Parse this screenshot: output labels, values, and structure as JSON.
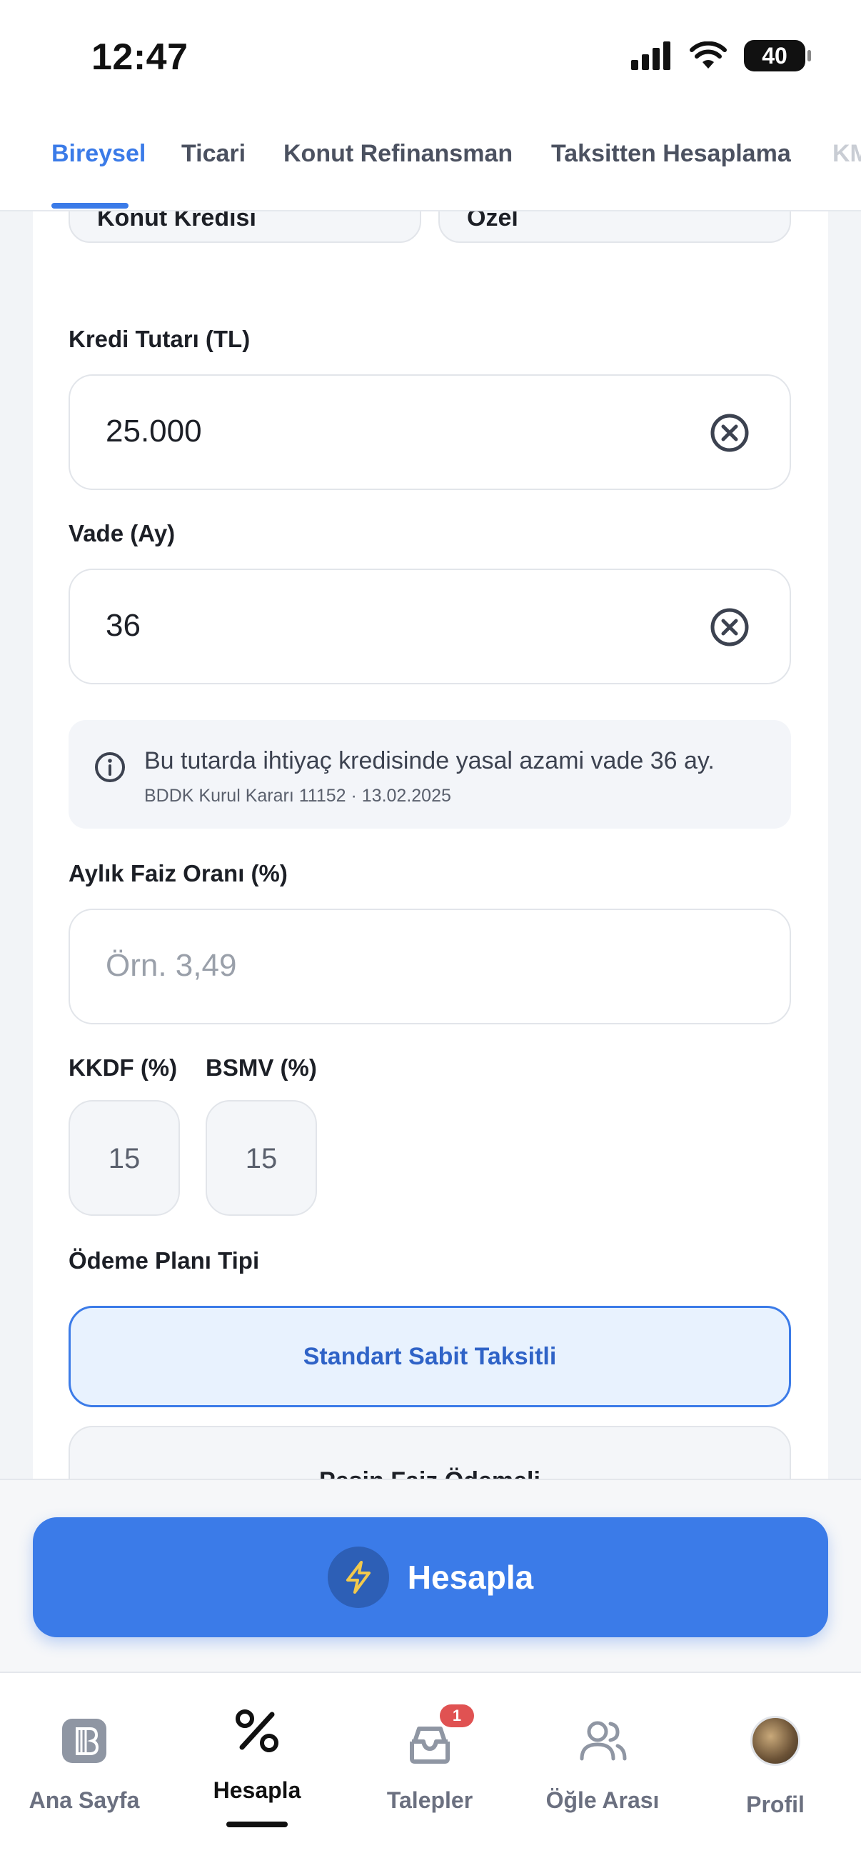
{
  "status_bar": {
    "time": "12:47",
    "battery": "40"
  },
  "tabs": [
    {
      "label": "Bireysel",
      "active": true
    },
    {
      "label": "Ticari"
    },
    {
      "label": "Konut Refinansman"
    },
    {
      "label": "Taksitten Hesaplama"
    },
    {
      "label": "KM"
    }
  ],
  "segments": {
    "left": "Konut Kredisi",
    "right": "Özel"
  },
  "loan_amount": {
    "label": "Kredi Tutarı (TL)",
    "value": "25.000"
  },
  "term": {
    "label": "Vade (Ay)",
    "value": "36"
  },
  "info": {
    "message": "Bu tutarda ihtiyaç kredisinde yasal azami vade 36 ay.",
    "source": "BDDK Kurul Kararı 11152 · 13.02.2025"
  },
  "interest": {
    "label": "Aylık Faiz Oranı (%)",
    "placeholder": "Örn. 3,49"
  },
  "kkdf": {
    "label": "KKDF (%)",
    "value": "15"
  },
  "bsmv": {
    "label": "BSMV (%)",
    "value": "15"
  },
  "payment_plan": {
    "label": "Ödeme Planı Tipi",
    "options": [
      "Standart Sabit Taksitli",
      "Peşin Faiz Ödemeli"
    ],
    "selected": "Standart Sabit Taksitli"
  },
  "action": {
    "calculate_label": "Hesapla"
  },
  "bottom_nav": [
    {
      "label": "Ana Sayfa",
      "icon": "home-logo-icon"
    },
    {
      "label": "Hesapla",
      "icon": "percent-icon",
      "active": true
    },
    {
      "label": "Talepler",
      "icon": "inbox-icon",
      "badge": "1"
    },
    {
      "label": "Öğle Arası",
      "icon": "users-icon"
    },
    {
      "label": "Profil",
      "icon": "avatar"
    }
  ],
  "colors": {
    "accent": "#3b7be8",
    "selected_bg": "#e8f2fe",
    "badge": "#e05252"
  }
}
